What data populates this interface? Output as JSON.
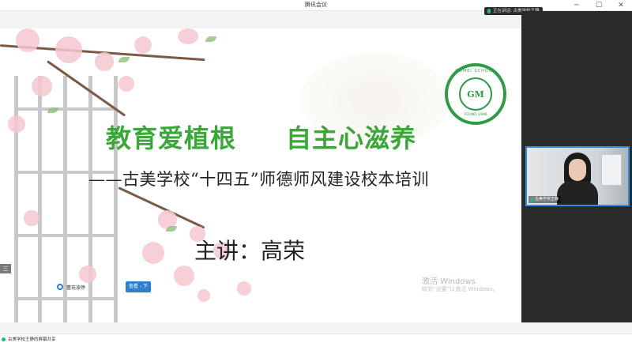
{
  "window": {
    "title": "腾讯会议",
    "minimize_glyph": "─",
    "maximize_glyph": "☐",
    "close_glyph": "✕"
  },
  "speaking": {
    "text": "正在讲话: 古美学校王静"
  },
  "slide": {
    "headline_left": "教育爱植根",
    "headline_right": "自主心滋养",
    "subtitle": "——古美学校“十四五”师德师风建设校本培训",
    "speaker": "主讲：高荣",
    "logo": {
      "ring_text": "GUMEI SCHOOL",
      "center": "GM",
      "year": "FOUND 1996"
    },
    "activate_title": "激活 Windows",
    "activate_sub": "转到“设置”以激活 Windows。"
  },
  "slide_toolbar": {
    "left_label": "蕾花旅停",
    "button_label": "查看 - 下"
  },
  "side_mini_label": "三",
  "video_tile": {
    "name": "古美学校王静"
  },
  "statusbar": {
    "text": "古美学校王静的屏幕共享"
  },
  "colors": {
    "headline": "#3aa838",
    "accent_blue": "#2f8ee8",
    "panel_dark": "#2a2a2a"
  }
}
